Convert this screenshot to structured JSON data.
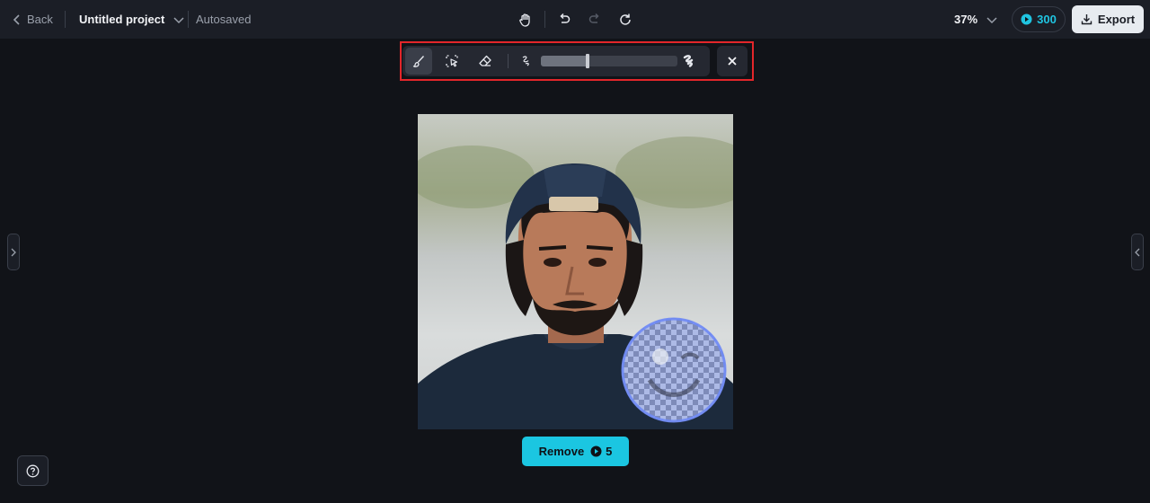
{
  "header": {
    "back_label": "Back",
    "project_title": "Untitled project",
    "autosave_status": "Autosaved",
    "zoom_level": "37%",
    "credits": "300",
    "export_label": "Export"
  },
  "icons": {
    "back": "chevron-left-icon",
    "project_menu": "chevron-down-icon",
    "hand": "hand-pan-icon",
    "undo": "undo-icon",
    "redo": "redo-icon",
    "refresh": "refresh-icon",
    "credits": "credit-coin-icon",
    "export": "download-icon",
    "brush": "brush-icon",
    "smart_select": "smart-select-icon",
    "eraser": "eraser-icon",
    "size_small": "brush-size-small-icon",
    "size_large": "brush-size-large-icon",
    "close": "close-icon",
    "help": "help-icon"
  },
  "brush_toolbar": {
    "active_tool": "brush",
    "brush_size_fraction": 0.34
  },
  "action": {
    "remove_label": "Remove",
    "remove_cost": "5"
  },
  "colors": {
    "accent": "#1bc6e1",
    "background": "#111318",
    "topbar": "#1b1e26",
    "highlight": "#e3262a",
    "mask": "#5f7ef0"
  }
}
